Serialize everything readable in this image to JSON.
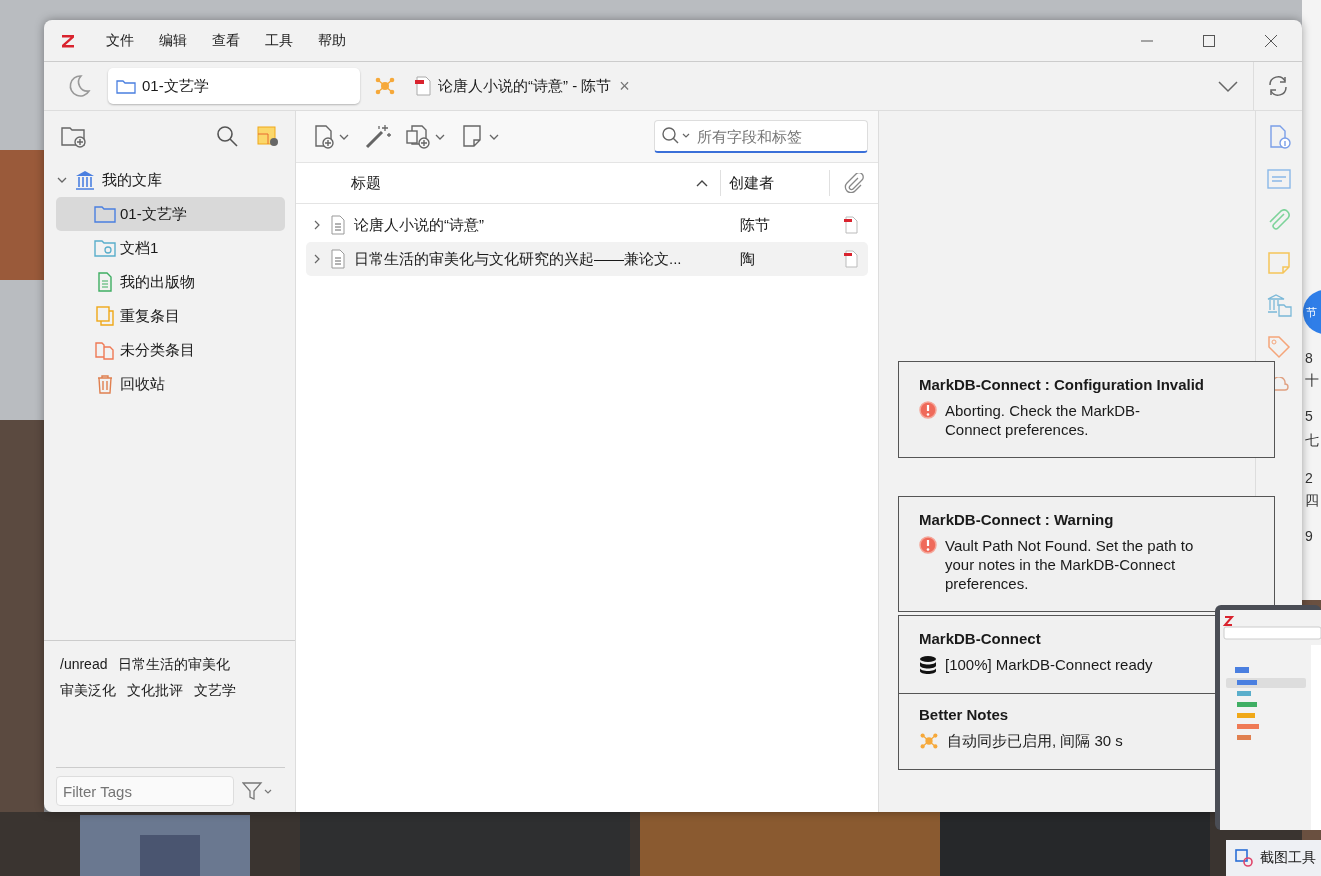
{
  "window": {
    "menu": [
      "文件",
      "编辑",
      "查看",
      "工具",
      "帮助"
    ]
  },
  "tabs": [
    {
      "kind": "library",
      "label": "01-文艺学",
      "selected": true
    },
    {
      "kind": "reader",
      "label": "论唐人小说的“诗意” - 陈节",
      "close": "×",
      "selected": false
    }
  ],
  "collections": {
    "label": "我的文库",
    "expanded": true,
    "children": [
      {
        "kind": "folder",
        "label": "01-文艺学",
        "selected": true
      },
      {
        "kind": "search",
        "label": "文档1",
        "selected": false
      },
      {
        "kind": "publications",
        "label": "我的出版物",
        "selected": false
      },
      {
        "kind": "duplicates",
        "label": "重复条目",
        "selected": false
      },
      {
        "kind": "unfiled",
        "label": "未分类条目",
        "selected": false
      },
      {
        "kind": "trash",
        "label": "回收站",
        "selected": false
      }
    ]
  },
  "search": {
    "placeholder": "所有字段和标签"
  },
  "table": {
    "columns": [
      "标题",
      "创建者"
    ],
    "rows": [
      {
        "title": "论唐人小说的“诗意”",
        "creator": "陈节",
        "selected": false
      },
      {
        "title": "日常生活的审美化与文化研究的兴起——兼论文...",
        "creator": "陶",
        "selected": true
      }
    ]
  },
  "tags": [
    "/unread",
    "日常生活的审美化",
    "审美泛化",
    "文化批评",
    "文艺学"
  ],
  "tag_filter": {
    "placeholder": "Filter Tags"
  },
  "notifications": [
    {
      "kind": "error",
      "title": "MarkDB-Connect : Configuration Invalid",
      "message": "Aborting. Check the MarkDB-Connect preferences."
    },
    {
      "kind": "error",
      "title": "MarkDB-Connect : Warning",
      "message": "Vault Path Not Found. Set the path to your notes in the MarkDB-Connect preferences."
    },
    {
      "kind": "database",
      "title": "MarkDB-Connect",
      "message": "[100%] MarkDB-Connect ready"
    },
    {
      "kind": "sync",
      "title": "Better Notes",
      "message": "自动同步已启用, 间隔 30 s"
    }
  ],
  "desktop": {
    "calendar_badge": "节",
    "calendar": [
      "8",
      "十",
      "5",
      "七",
      "2",
      "四",
      "9"
    ],
    "taskbar_label": "截图工具"
  }
}
